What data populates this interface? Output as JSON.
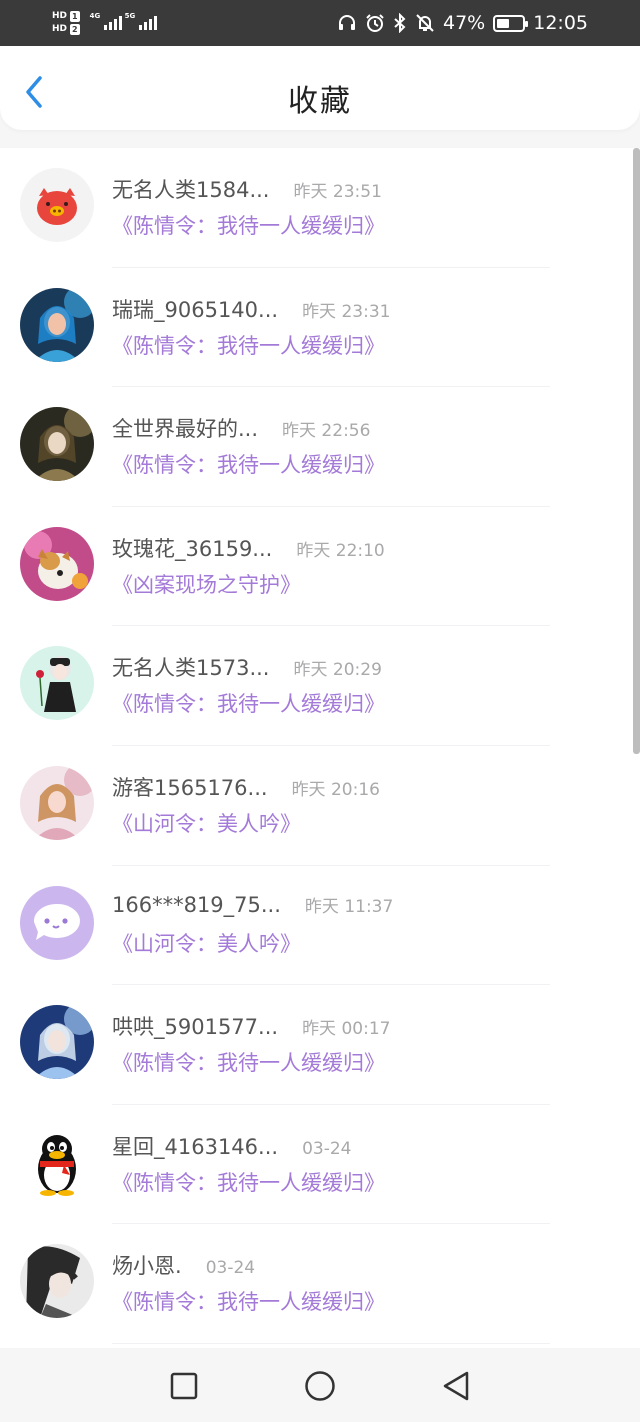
{
  "status_bar": {
    "hd1": "HD",
    "hd1_num": "1",
    "hd2": "HD",
    "hd2_num": "2",
    "net1": "4G",
    "net2": "5G",
    "battery_text": "47%",
    "battery_level": 0.47,
    "time": "12:05",
    "icons": [
      "headphones-icon",
      "alarm-icon",
      "bluetooth-icon",
      "mute-bell-icon"
    ]
  },
  "header": {
    "title": "收藏",
    "back_icon": "chevron-left-icon",
    "accent_color": "#2e8ee6"
  },
  "colors": {
    "book_title": "#a47ad8",
    "time": "#a9a9ab",
    "username": "#555555"
  },
  "items": [
    {
      "name": "无名人类1584...",
      "time": "昨天 23:51",
      "book": "《陈情令：我待一人缓缓归》",
      "avatar": "pig-avatar"
    },
    {
      "name": "瑞瑞_9065140...",
      "time": "昨天 23:31",
      "book": "《陈情令：我待一人缓缓归》",
      "avatar": "photo-avatar"
    },
    {
      "name": "全世界最好的...",
      "time": "昨天 22:56",
      "book": "《陈情令：我待一人缓缓归》",
      "avatar": "photo-avatar"
    },
    {
      "name": "玫瑰花_36159...",
      "time": "昨天 22:10",
      "book": "《凶案现场之守护》",
      "avatar": "dog-avatar"
    },
    {
      "name": "无名人类1573...",
      "time": "昨天 20:29",
      "book": "《陈情令：我待一人缓缓归》",
      "avatar": "anime-girl-avatar"
    },
    {
      "name": "游客1565176...",
      "time": "昨天 20:16",
      "book": "《山河令：美人吟》",
      "avatar": "photo-avatar"
    },
    {
      "name": "166***819_75...",
      "time": "昨天 11:37",
      "book": "《山河令：美人吟》",
      "avatar": "chat-bubble-avatar"
    },
    {
      "name": "哄哄_5901577...",
      "time": "昨天 00:17",
      "book": "《陈情令：我待一人缓缓归》",
      "avatar": "photo-avatar"
    },
    {
      "name": "星回_4163146...",
      "time": "03-24",
      "book": "《陈情令：我待一人缓缓归》",
      "avatar": "penguin-avatar"
    },
    {
      "name": "炀小恩.",
      "time": "03-24",
      "book": "《陈情令：我待一人缓缓归》",
      "avatar": "sketch-avatar"
    }
  ],
  "nav_bar": {
    "icons": [
      "recent-apps-icon",
      "home-icon",
      "back-icon"
    ]
  }
}
